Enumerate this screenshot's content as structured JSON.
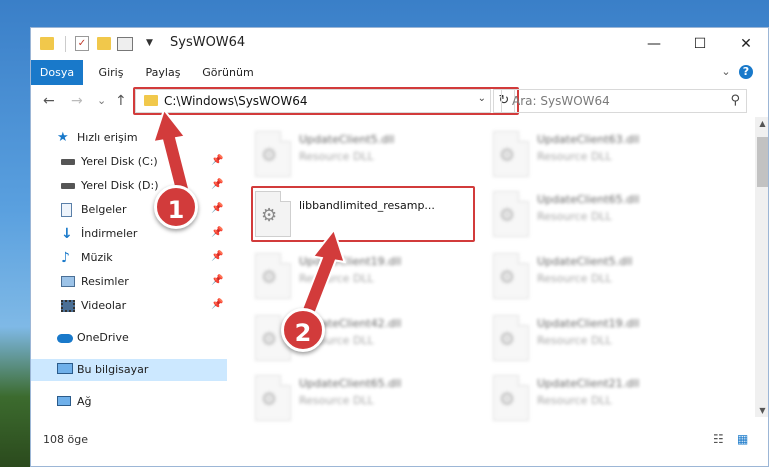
{
  "window": {
    "title": "SysWOW64",
    "minimize_glyph": "—",
    "maximize_glyph": "☐",
    "close_glyph": "✕"
  },
  "ribbon": {
    "tabs": [
      {
        "label": "Dosya"
      },
      {
        "label": "Giriş"
      },
      {
        "label": "Paylaş"
      },
      {
        "label": "Görünüm"
      }
    ],
    "expand_icon": "chevron-down-icon",
    "help_icon": "help-icon",
    "help_glyph": "?"
  },
  "nav": {
    "back_glyph": "←",
    "forward_glyph": "→",
    "recent_glyph": "⌄",
    "up_glyph": "↑",
    "address": "C:\\Windows\\SysWOW64",
    "dropdown_glyph": "⌄",
    "refresh_glyph": "↻",
    "search_placeholder": "Ara: SysWOW64",
    "search_glyph": "⚲"
  },
  "sidebar": {
    "items": [
      {
        "label": "Hızlı erişim",
        "icon": "star-icon",
        "pinned": false
      },
      {
        "label": "Yerel Disk (C:)",
        "icon": "drive-icon",
        "pinned": true
      },
      {
        "label": "Yerel Disk (D:)",
        "icon": "drive-icon",
        "pinned": true
      },
      {
        "label": "Belgeler",
        "icon": "documents-icon",
        "pinned": true
      },
      {
        "label": "İndirmeler",
        "icon": "download-icon",
        "pinned": true
      },
      {
        "label": "Müzik",
        "icon": "music-icon",
        "pinned": true
      },
      {
        "label": "Resimler",
        "icon": "pictures-icon",
        "pinned": true
      },
      {
        "label": "Videolar",
        "icon": "videos-icon",
        "pinned": true
      },
      {
        "label": "OneDrive",
        "icon": "cloud-icon",
        "pinned": false
      },
      {
        "label": "Bu bilgisayar",
        "icon": "computer-icon",
        "pinned": false,
        "selected": true
      },
      {
        "label": "Ağ",
        "icon": "network-icon",
        "pinned": false
      }
    ],
    "pin_glyph": "📌"
  },
  "files": {
    "highlighted": {
      "name": "libbandlimited_resamp...",
      "type": ""
    },
    "blurred": [
      {
        "name": "UpdateClient5.dll",
        "type": "Resource DLL"
      },
      {
        "name": "UpdateClient63.dll",
        "type": "Resource DLL"
      },
      {
        "name": "UpdateClient65.dll",
        "type": "Resource DLL"
      },
      {
        "name": "UpdateClient19.dll",
        "type": "Resource DLL"
      },
      {
        "name": "UpdateClient5.dll",
        "type": "Resource DLL"
      },
      {
        "name": "UpdateClient42.dll",
        "type": "Resource DLL"
      },
      {
        "name": "UpdateClient19.dll",
        "type": "Resource DLL"
      },
      {
        "name": "UpdateClient65.dll",
        "type": "Resource DLL"
      },
      {
        "name": "UpdateClient21.dll",
        "type": "Resource DLL"
      }
    ],
    "gear_glyph": "⚙"
  },
  "status": {
    "count": "108 öge",
    "details_view_glyph": "☷",
    "icons_view_glyph": "▦"
  },
  "annotations": {
    "step1": "1",
    "step2": "2",
    "color": "#d23b3b"
  }
}
